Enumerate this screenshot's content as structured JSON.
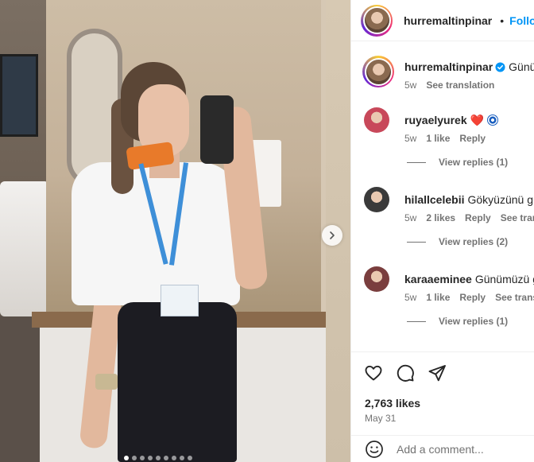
{
  "post": {
    "image_dots_count": 9,
    "next_icon": "chevron-right-icon"
  },
  "header": {
    "username": "hurremaltinpinar",
    "verified_icon": "verified-badge-icon",
    "separator": "•",
    "follow_label": "Follo"
  },
  "caption": {
    "username": "hurremaltinpinar",
    "text": "Günün",
    "time": "5w",
    "see_translation": "See translation"
  },
  "comments": [
    {
      "username": "ruyaelyurek",
      "text": "❤️",
      "has_eye_emoji": true,
      "time": "5w",
      "likes": "1 like",
      "reply": "Reply",
      "extra": "",
      "view_replies": "View replies (1)",
      "avatar_color": "#c8485a"
    },
    {
      "username": "hilallcelebii",
      "text": "Gökyüzünü gü",
      "time": "5w",
      "likes": "2 likes",
      "reply": "Reply",
      "extra": "See trans",
      "view_replies": "View replies (2)",
      "avatar_color": "#3a3a3a"
    },
    {
      "username": "karaaeminee",
      "text": "Günümüzü g",
      "time": "5w",
      "likes": "1 like",
      "reply": "Reply",
      "extra": "See transla",
      "view_replies": "View replies (1)",
      "avatar_color": "#7a3e3e"
    }
  ],
  "actions": {
    "like_icon": "heart-icon",
    "comment_icon": "comment-icon",
    "share_icon": "share-icon",
    "likes": "2,763 likes",
    "date": "May 31"
  },
  "add_comment": {
    "emoji_icon": "emoji-icon",
    "placeholder": "Add a comment..."
  },
  "colors": {
    "link_blue": "#0095f6",
    "muted_text": "#737373",
    "primary_text": "#262626",
    "border": "#efefef"
  }
}
